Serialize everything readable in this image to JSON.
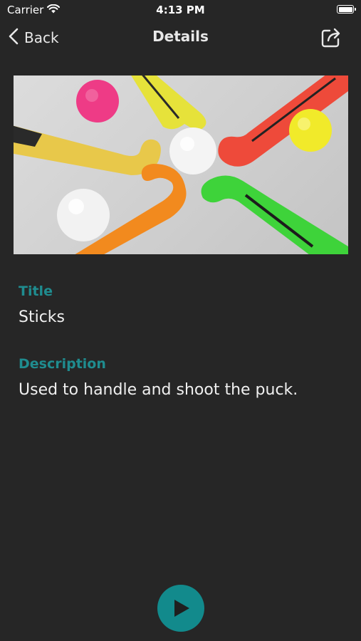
{
  "status_bar": {
    "carrier": "Carrier",
    "time": "4:13 PM"
  },
  "nav": {
    "back_label": "Back",
    "title": "Details",
    "share_icon": "share-icon"
  },
  "hero": {
    "image": "hockey-sticks-photo"
  },
  "detail": {
    "title_label": "Title",
    "title_value": "Sticks",
    "description_label": "Description",
    "description_value": "Used to handle and shoot the puck."
  },
  "player": {
    "play_icon": "play-icon"
  },
  "colors": {
    "background": "#262626",
    "accent": "#1f8c8f",
    "play_button": "#128a8c"
  }
}
